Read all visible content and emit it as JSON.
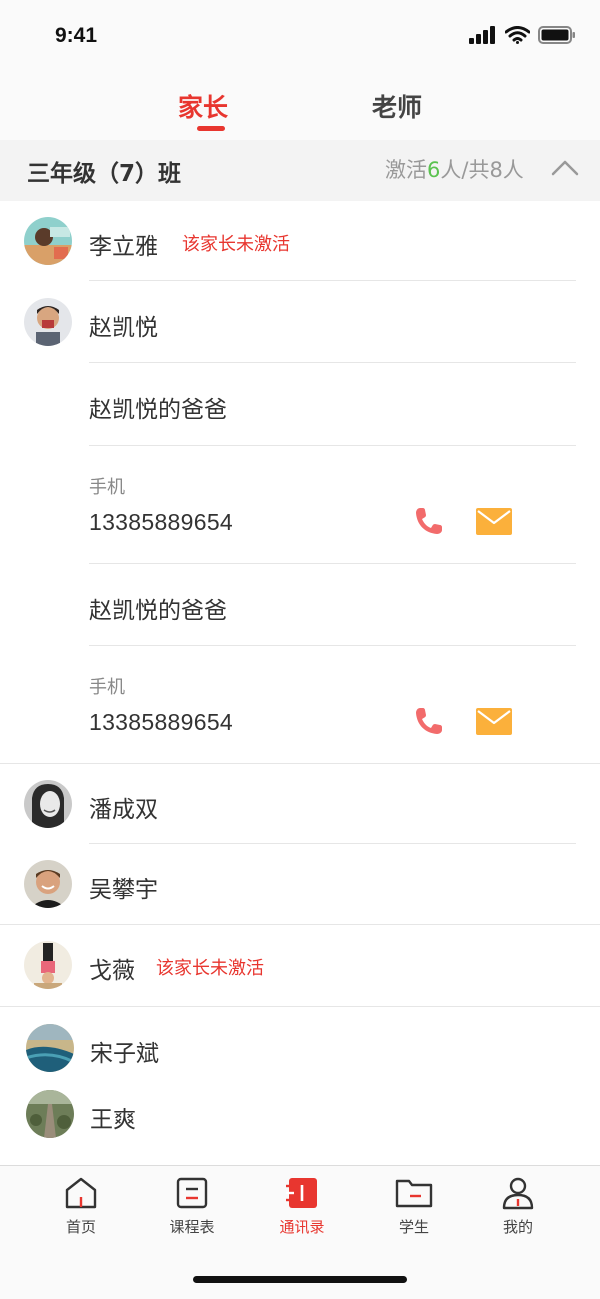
{
  "status_bar": {
    "time": "9:41"
  },
  "tabs": {
    "parent_label": "家长",
    "teacher_label": "老师"
  },
  "class_header": {
    "class_name": "三年级（7）班",
    "stats_prefix": "激活",
    "activated": "6",
    "stats_suffix": "人/共8人"
  },
  "contacts": [
    {
      "name": "李立雅",
      "badge": "该家长未激活"
    },
    {
      "name": "赵凯悦",
      "guardians": [
        {
          "relation": "赵凯悦的爸爸",
          "phone_label": "手机",
          "phone": "13385889654"
        },
        {
          "relation": "赵凯悦的爸爸",
          "phone_label": "手机",
          "phone": "13385889654"
        }
      ]
    },
    {
      "name": "潘成双"
    },
    {
      "name": "吴攀宇"
    },
    {
      "name": "戈薇",
      "badge": "该家长未激活"
    },
    {
      "name": "宋子斌"
    },
    {
      "name": "王爽"
    }
  ],
  "tabbar": {
    "items": [
      {
        "label": "首页",
        "icon": "home-icon"
      },
      {
        "label": "课程表",
        "icon": "schedule-icon"
      },
      {
        "label": "通讯录",
        "icon": "contacts-icon"
      },
      {
        "label": "学生",
        "icon": "folder-icon"
      },
      {
        "label": "我的",
        "icon": "profile-icon"
      }
    ],
    "active_index": 2
  },
  "colors": {
    "accent": "#e8362f",
    "active_count": "#5ac24f",
    "phone_icon": "#f26b6b",
    "mail_icon": "#fbb03b"
  }
}
